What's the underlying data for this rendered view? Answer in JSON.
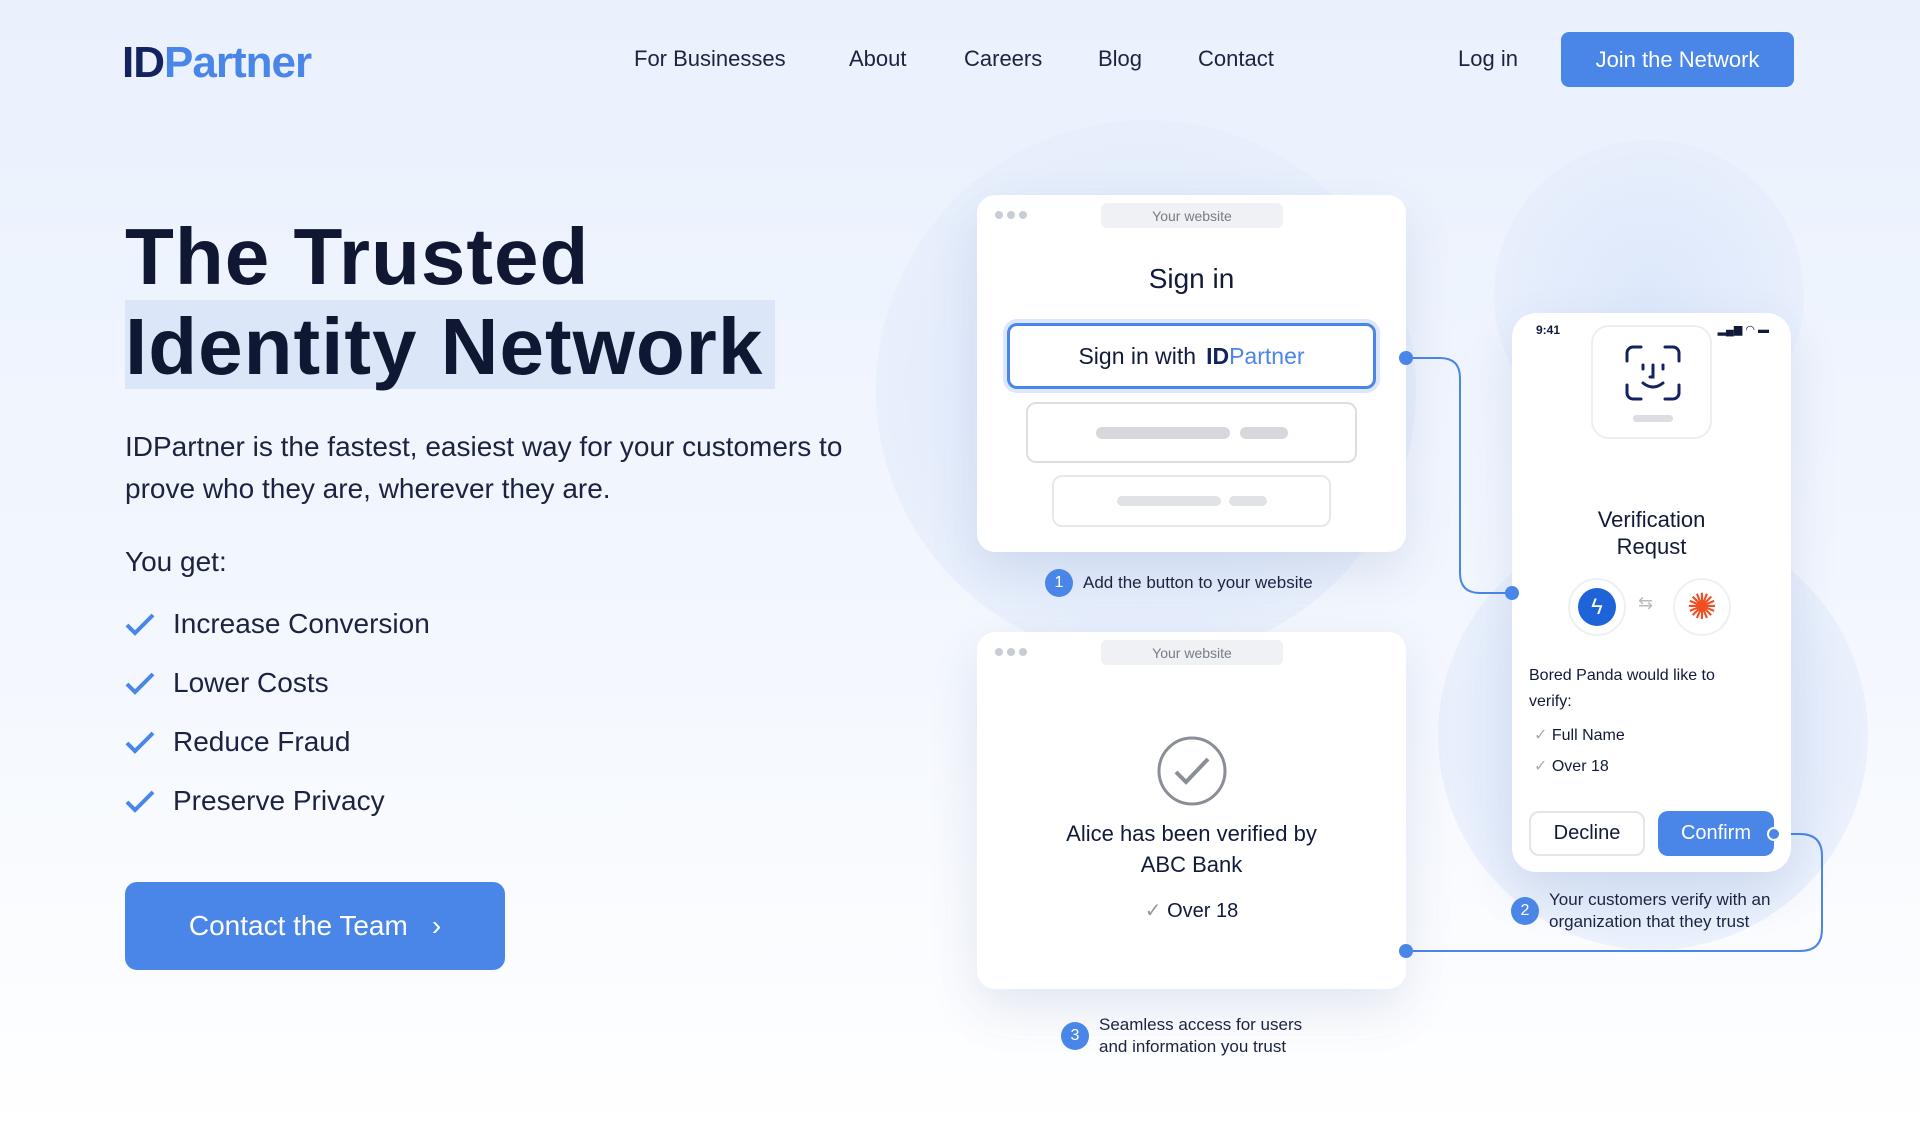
{
  "header": {
    "logo": {
      "id": "ID",
      "partner": "Partner"
    },
    "nav": [
      "For Businesses",
      "About",
      "Careers",
      "Blog",
      "Contact"
    ],
    "login": "Log in",
    "join": "Join the Network"
  },
  "hero": {
    "title_line1": "The Trusted",
    "title_line2": "Identity Network",
    "description": "IDPartner is the fastest, easiest way for your customers to prove who they are, wherever they are.",
    "you_get": "You get:",
    "benefits": [
      "Increase Conversion",
      "Lower Costs",
      "Reduce Fraud",
      "Preserve Privacy"
    ],
    "cta": "Contact the Team"
  },
  "signin_card": {
    "url": "Your website",
    "title": "Sign in",
    "button_prefix": "Sign in with",
    "caption_num": "1",
    "caption": "Add the button to your website"
  },
  "verified_card": {
    "url": "Your website",
    "message": "Alice has been verified by ABC Bank",
    "attribute": "Over 18",
    "caption_num": "3",
    "caption": "Seamless access for users and information you trust"
  },
  "phone": {
    "time": "9:41",
    "title": "Verification Requst",
    "request": "Bored Panda would like to verify:",
    "attributes": [
      "Full Name",
      "Over 18"
    ],
    "decline": "Decline",
    "confirm": "Confirm",
    "caption_num": "2",
    "caption": "Your customers verify with an organization that they trust"
  },
  "colors": {
    "accent": "#4a86e8",
    "navy": "#13235e",
    "orange": "#f04e23"
  }
}
